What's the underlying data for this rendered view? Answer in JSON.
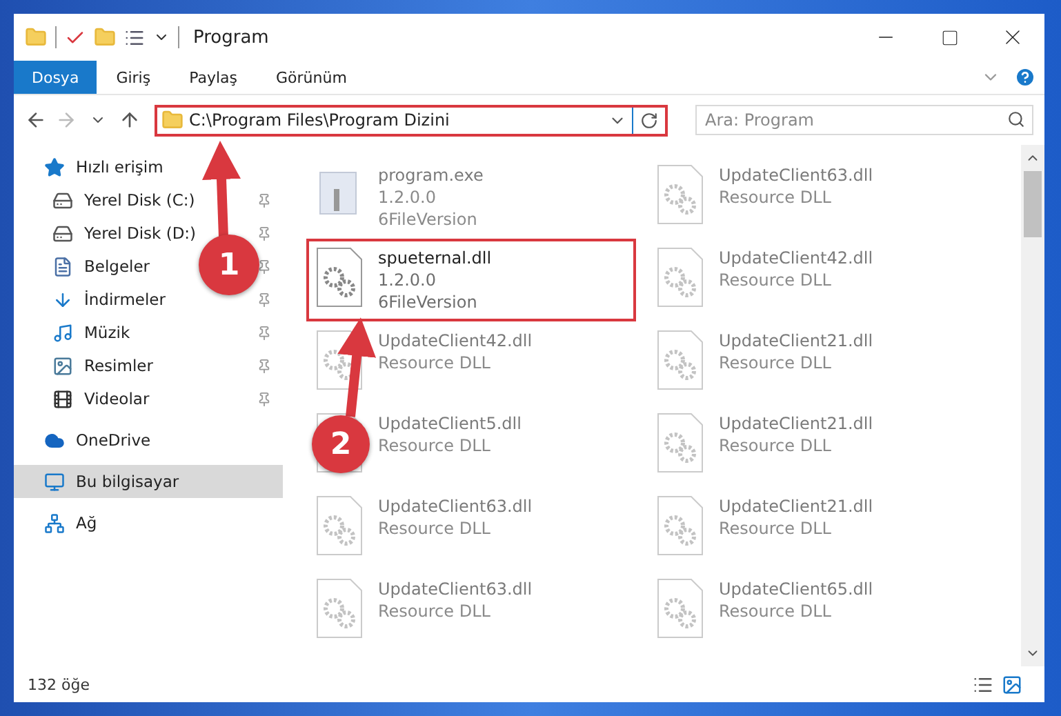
{
  "window": {
    "title": "Program"
  },
  "ribbon_tabs": [
    {
      "label": "Dosya",
      "selected": true
    },
    {
      "label": "Giriş",
      "selected": false
    },
    {
      "label": "Paylaş",
      "selected": false
    },
    {
      "label": "Görünüm",
      "selected": false
    }
  ],
  "address_bar": {
    "value": "C:\\Program Files\\Program Dizini",
    "highlighted": true
  },
  "search": {
    "placeholder": "Ara: Program"
  },
  "sidebar": {
    "items": [
      {
        "kind": "star",
        "label": "Hızlı erişim",
        "selected": false,
        "children": [
          {
            "kind": "drive-c",
            "label": "Yerel Disk (C:)",
            "pinned": true,
            "selected": false
          },
          {
            "kind": "drive",
            "label": "Yerel Disk (D:)",
            "pinned": true,
            "selected": false
          },
          {
            "kind": "docs",
            "label": "Belgeler",
            "pinned": true,
            "selected": false
          },
          {
            "kind": "downloads",
            "label": "İndirmeler",
            "pinned": true,
            "selected": false
          },
          {
            "kind": "music",
            "label": "Müzik",
            "pinned": true,
            "selected": false
          },
          {
            "kind": "pictures",
            "label": "Resimler",
            "pinned": true,
            "selected": false
          },
          {
            "kind": "videos",
            "label": "Videolar",
            "pinned": true,
            "selected": false
          }
        ]
      },
      {
        "kind": "cloud",
        "label": "OneDrive",
        "selected": false
      },
      {
        "kind": "pc",
        "label": "Bu bilgisayar",
        "selected": true
      },
      {
        "kind": "network",
        "label": "Ağ",
        "selected": false
      }
    ]
  },
  "files": [
    {
      "kind": "exe",
      "name": "program.exe",
      "lines": [
        "1.2.0.0",
        "6FileVersion"
      ],
      "faded": true,
      "highlighted": false
    },
    {
      "kind": "dll",
      "name": "spueternal.dll",
      "lines": [
        "1.2.0.0",
        "6FileVersion"
      ],
      "faded": false,
      "highlighted": true
    },
    {
      "kind": "dll",
      "name": "UpdateClient42.dll",
      "lines": [
        "Resource DLL"
      ],
      "faded": true,
      "highlighted": false
    },
    {
      "kind": "dll",
      "name": "UpdateClient5.dll",
      "lines": [
        "Resource DLL"
      ],
      "faded": true,
      "highlighted": false
    },
    {
      "kind": "dll",
      "name": "UpdateClient63.dll",
      "lines": [
        "Resource DLL"
      ],
      "faded": true,
      "highlighted": false
    },
    {
      "kind": "dll",
      "name": "UpdateClient63.dll",
      "lines": [
        "Resource DLL"
      ],
      "faded": true,
      "highlighted": false
    },
    {
      "kind": "dll",
      "name": "UpdateClient63.dll",
      "lines": [
        "Resource DLL"
      ],
      "faded": true,
      "highlighted": false
    },
    {
      "kind": "dll",
      "name": "UpdateClient42.dll",
      "lines": [
        "Resource DLL"
      ],
      "faded": true,
      "highlighted": false
    },
    {
      "kind": "dll",
      "name": "UpdateClient21.dll",
      "lines": [
        "Resource DLL"
      ],
      "faded": true,
      "highlighted": false
    },
    {
      "kind": "dll",
      "name": "UpdateClient21.dll",
      "lines": [
        "Resource DLL"
      ],
      "faded": true,
      "highlighted": false
    },
    {
      "kind": "dll",
      "name": "UpdateClient21.dll",
      "lines": [
        "Resource DLL"
      ],
      "faded": true,
      "highlighted": false
    },
    {
      "kind": "dll",
      "name": "UpdateClient65.dll",
      "lines": [
        "Resource DLL"
      ],
      "faded": true,
      "highlighted": false
    }
  ],
  "annotations": [
    {
      "number": "1"
    },
    {
      "number": "2"
    }
  ],
  "status_bar": {
    "count": "132 öğe"
  }
}
